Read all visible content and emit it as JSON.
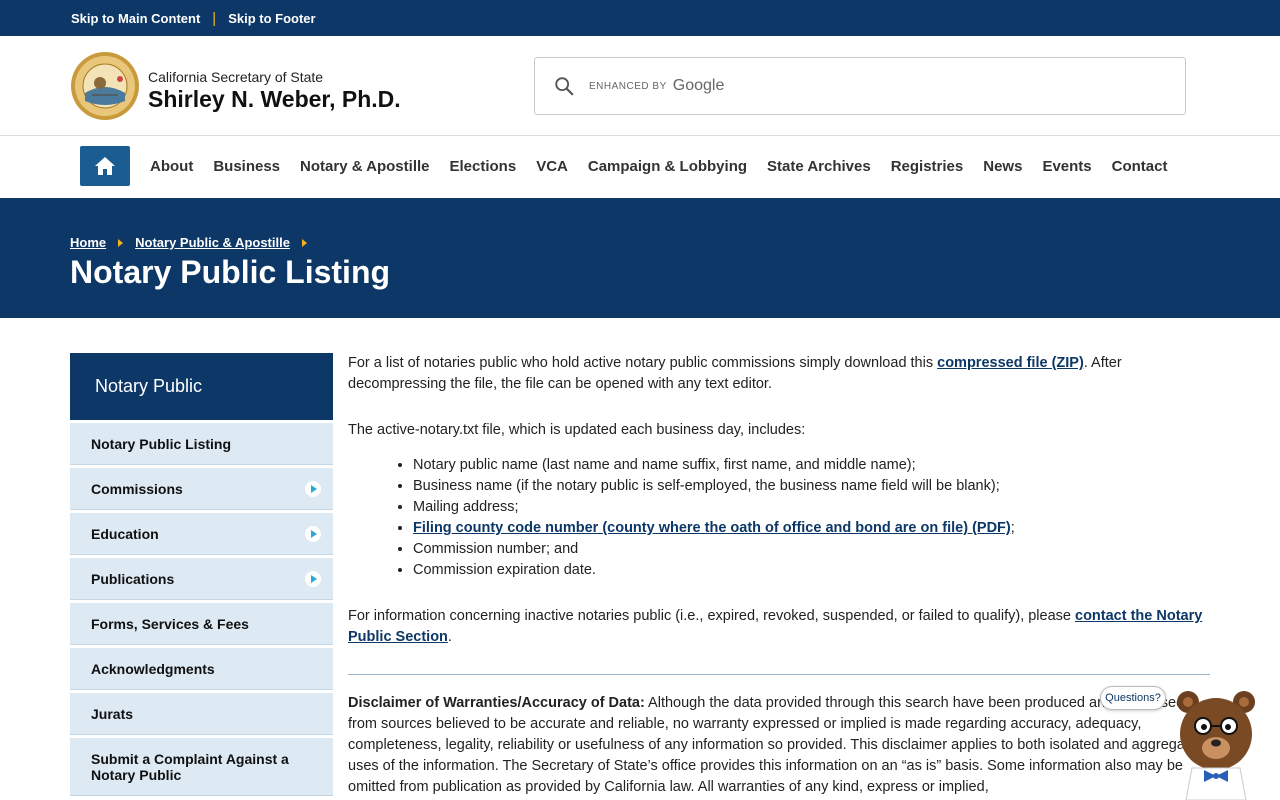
{
  "skip": {
    "main": "Skip to Main Content",
    "sep": "|",
    "footer": "Skip to Footer"
  },
  "header": {
    "subtitle": "California Secretary of State",
    "name": "Shirley N. Weber, Ph.D.",
    "search_enhanced": "ENHANCED BY",
    "search_google": "Google"
  },
  "nav": {
    "items": [
      "About",
      "Business",
      "Notary & Apostille",
      "Elections",
      "VCA",
      "Campaign & Lobbying",
      "State Archives",
      "Registries",
      "News",
      "Events",
      "Contact"
    ]
  },
  "breadcrumb": {
    "home": "Home",
    "section": "Notary Public & Apostille"
  },
  "page_title": "Notary Public Listing",
  "sidebar": {
    "heading": "Notary Public",
    "items": [
      {
        "label": "Notary Public Listing"
      },
      {
        "label": "Commissions"
      },
      {
        "label": "Education"
      },
      {
        "label": "Publications"
      },
      {
        "label": "Forms, Services & Fees"
      },
      {
        "label": "Acknowledgments"
      },
      {
        "label": "Jurats"
      },
      {
        "label": "Submit a Complaint Against a Notary Public"
      }
    ]
  },
  "content": {
    "p1_a": "For a list of notaries public who hold active notary public commissions simply download this ",
    "p1_link": "compressed file (ZIP)",
    "p1_b": ". After decompressing the file, the file can be opened with any text editor.",
    "p2": "The active-notary.txt file, which is updated each business day, includes:",
    "list": [
      "Notary public name (last name and name suffix, first name, and middle name);",
      "Business name (if the notary public is self-employed, the business name field will be blank);",
      "Mailing address;",
      "Filing county code number (county where the oath of office and bond are on file) (PDF)",
      "Commission number; and",
      "Commission expiration date."
    ],
    "list_link_suffix": ";",
    "p3_a": "For information concerning inactive notaries public (i.e., expired, revoked, suspended, or failed to qualify), please ",
    "p3_link": "contact the Notary Public Section",
    "p3_b": ".",
    "disclaimer_label": "Disclaimer of Warranties/Accuracy of Data:",
    "disclaimer_text": " Although the data provided through this search have been produced and processed from sources believed to be accurate and reliable, no warranty expressed or implied is made regarding accuracy, adequacy, completeness, legality, reliability or usefulness of any information so provided. This disclaimer applies to both isolated and aggregate uses of the information. The Secretary of State’s office provides this information on an “as is” basis. Some information also may be omitted from publication as provided by California law. All warranties of any kind, express or implied,"
  },
  "widget": {
    "bubble": "Questions?"
  },
  "colors": {
    "navy": "#0c3766",
    "accent": "#f5b120",
    "home_btn": "#1a5d92",
    "side_bg": "#dde9f3"
  }
}
